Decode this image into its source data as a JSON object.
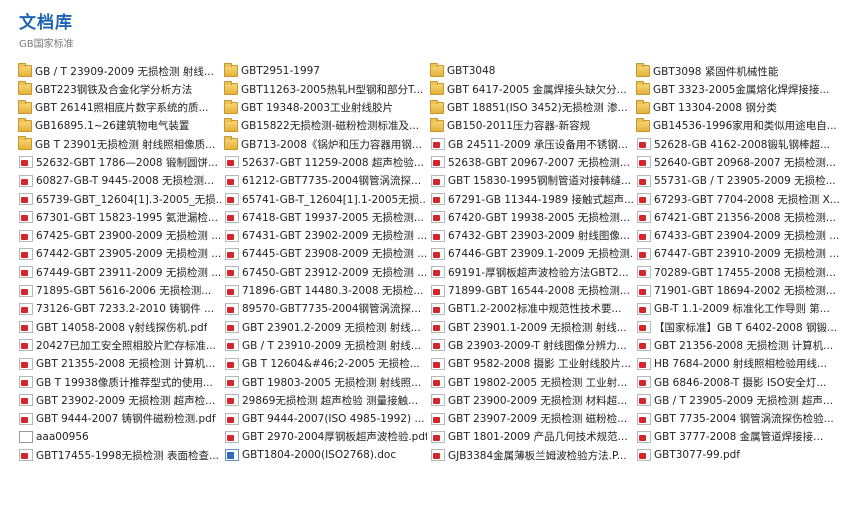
{
  "header": {
    "title": "文档库",
    "subtitle": "GB国家标准"
  },
  "files": [
    {
      "type": "folder",
      "name": "GB / T 23909-2009 无损检测 射线..."
    },
    {
      "type": "folder",
      "name": "GBT2951-1997"
    },
    {
      "type": "folder",
      "name": "GBT3048"
    },
    {
      "type": "folder",
      "name": "GBT3098 紧固件机械性能"
    },
    {
      "type": "folder",
      "name": "GBT223钢铁及合金化学分析方法"
    },
    {
      "type": "folder",
      "name": "GBT11263-2005热轧H型钢和部分T..."
    },
    {
      "type": "folder",
      "name": "GBT 6417-2005 金属焊接头缺欠分..."
    },
    {
      "type": "folder",
      "name": "GBT 3323-2005金属熔化焊焊接接..."
    },
    {
      "type": "folder",
      "name": "GBT 26141照相底片数字系统的质..."
    },
    {
      "type": "folder",
      "name": "GBT 19348-2003工业射线胶片"
    },
    {
      "type": "folder",
      "name": "GBT 18851(ISO 3452)无损检测 渗..."
    },
    {
      "type": "folder",
      "name": "GBT 13304-2008 钢分类"
    },
    {
      "type": "folder",
      "name": "GB16895.1~26建筑物电气装置"
    },
    {
      "type": "folder",
      "name": "GB15822无损检测-磁粉检测标准及..."
    },
    {
      "type": "folder",
      "name": "GB150-2011压力容器-新容规"
    },
    {
      "type": "folder",
      "name": "GB14536-1996家用和类似用途电自..."
    },
    {
      "type": "folder",
      "name": "GB T 23901无损检测 射线照相像质..."
    },
    {
      "type": "folder",
      "name": "GB713-2008《锅炉和压力容器用钢..."
    },
    {
      "type": "pdf",
      "name": "GB 24511-2009 承压设备用不锈钢..."
    },
    {
      "type": "pdf",
      "name": "52628-GB 4162-2008锻轧钢棒超..."
    },
    {
      "type": "pdf",
      "name": "52632-GBT 1786—2008 锻制圆饼..."
    },
    {
      "type": "pdf",
      "name": "52637-GBT 11259-2008 超声检验..."
    },
    {
      "type": "pdf",
      "name": "52638-GBT 20967-2007 无损检测..."
    },
    {
      "type": "pdf",
      "name": "52640-GBT 20968-2007 无损检测..."
    },
    {
      "type": "pdf",
      "name": "60827-GB-T 9445-2008 无损检测..."
    },
    {
      "type": "pdf",
      "name": "61212-GBT7735-2004钢管涡流探..."
    },
    {
      "type": "pdf",
      "name": "GBT 15830-1995钢制管道对接韩缝..."
    },
    {
      "type": "pdf",
      "name": "55731-GB / T 23905-2009 无损检..."
    },
    {
      "type": "pdf",
      "name": "65739-GBT_12604[1].3-2005_无损..."
    },
    {
      "type": "pdf",
      "name": "65741-GB-T_12604[1].1-2005无损..."
    },
    {
      "type": "pdf",
      "name": "67291-GB 11344-1989 接触式超声..."
    },
    {
      "type": "pdf",
      "name": "67293-GBT 7704-2008 无损检测 X..."
    },
    {
      "type": "pdf",
      "name": "67301-GBT 15823-1995 氦泄漏检..."
    },
    {
      "type": "pdf",
      "name": "67418-GBT 19937-2005 无损检测..."
    },
    {
      "type": "pdf",
      "name": "67420-GBT 19938-2005 无损检测..."
    },
    {
      "type": "pdf",
      "name": "67421-GBT 21356-2008 无损检测..."
    },
    {
      "type": "pdf",
      "name": "67425-GBT 23900-2009 无损检测 ..."
    },
    {
      "type": "pdf",
      "name": "67431-GBT 23902-2009 无损检测 ..."
    },
    {
      "type": "pdf",
      "name": "67432-GBT 23903-2009 射线图像..."
    },
    {
      "type": "pdf",
      "name": "67433-GBT 23904-2009 无损检测 ..."
    },
    {
      "type": "pdf",
      "name": "67442-GBT 23905-2009 无损检测 ..."
    },
    {
      "type": "pdf",
      "name": "67445-GBT 23908-2009 无损检测 ..."
    },
    {
      "type": "pdf",
      "name": "67446-GBT 23909.1-2009 无损检测..."
    },
    {
      "type": "pdf",
      "name": "67447-GBT 23910-2009 无损检测 ..."
    },
    {
      "type": "pdf",
      "name": "67449-GBT 23911-2009 无损检测 ..."
    },
    {
      "type": "pdf",
      "name": "67450-GBT 23912-2009 无损检测 ..."
    },
    {
      "type": "pdf",
      "name": "69191-厚钢板超声波检验方法GBT2..."
    },
    {
      "type": "pdf",
      "name": "70289-GBT 17455-2008 无损检测..."
    },
    {
      "type": "pdf",
      "name": "71895-GBT 5616-2006 无损检测..."
    },
    {
      "type": "pdf",
      "name": "71896-GBT 14480.3-2008 无损检..."
    },
    {
      "type": "pdf",
      "name": "71899-GBT 16544-2008 无损检测..."
    },
    {
      "type": "pdf",
      "name": "71901-GBT 18694-2002 无损检测..."
    },
    {
      "type": "pdf",
      "name": "73126-GBT 7233.2-2010 铸钢件 ..."
    },
    {
      "type": "pdf",
      "name": "89570-GBT7735-2004钢管涡流探..."
    },
    {
      "type": "pdf",
      "name": "GBT1.2-2002标准中规范性技术要..."
    },
    {
      "type": "pdf",
      "name": "GB-T 1.1-2009 标准化工作导则 第..."
    },
    {
      "type": "pdf",
      "name": "GBT 14058-2008 γ射线探伤机.pdf"
    },
    {
      "type": "pdf",
      "name": "GBT 23901.2-2009 无损检测 射线..."
    },
    {
      "type": "pdf",
      "name": "GBT 23901.1-2009 无损检测 射线..."
    },
    {
      "type": "pdf",
      "name": "【国家标准】GB T 6402-2008 钢锻..."
    },
    {
      "type": "pdf",
      "name": "20427已加工安全照相胶片贮存标准..."
    },
    {
      "type": "pdf",
      "name": "GB / T 23910-2009 无损检测 射线..."
    },
    {
      "type": "pdf",
      "name": "GB 23903-2009-T 射线图像分辨力..."
    },
    {
      "type": "pdf",
      "name": "GBT 21356-2008 无损检测 计算机..."
    },
    {
      "type": "pdf",
      "name": "GBT 21355-2008 无损检测 计算机..."
    },
    {
      "type": "pdf",
      "name": "GB T 12604&#46;2-2005 无损检..."
    },
    {
      "type": "pdf",
      "name": "GBT 9582-2008 摄影 工业射线胶片..."
    },
    {
      "type": "pdf",
      "name": "HB 7684-2000 射线照相检验用线..."
    },
    {
      "type": "pdf",
      "name": "GB T 19938像质计推荐型式的使用..."
    },
    {
      "type": "pdf",
      "name": "GBT 19803-2005 无损检测 射线照..."
    },
    {
      "type": "pdf",
      "name": "GBT 19802-2005  无损检测 工业射..."
    },
    {
      "type": "pdf",
      "name": "GB 6846-2008-T 摄影 ISO安全灯..."
    },
    {
      "type": "pdf",
      "name": "GBT 23902-2009 无损检测 超声检..."
    },
    {
      "type": "pdf",
      "name": "29869无损检测 超声检验 测量接触..."
    },
    {
      "type": "pdf",
      "name": "GBT 23900-2009 无损检测 材料超..."
    },
    {
      "type": "pdf",
      "name": "GB / T 23905-2009 无损检测 超声..."
    },
    {
      "type": "pdf",
      "name": "GBT 9444-2007 铸钢件磁粉检测.pdf"
    },
    {
      "type": "pdf",
      "name": "GBT 9444-2007(ISO 4985-1992) ..."
    },
    {
      "type": "pdf",
      "name": "GBT 23907-2009 无损检测 磁粉检..."
    },
    {
      "type": "pdf",
      "name": "GBT 7735-2004 钢管涡流探伤检验..."
    },
    {
      "type": "file",
      "name": "aaa00956"
    },
    {
      "type": "pdf",
      "name": "GBT 2970-2004厚钢板超声波检验.pdf"
    },
    {
      "type": "pdf",
      "name": "GBT 1801-2009 产品几何技术规范..."
    },
    {
      "type": "pdf",
      "name": "GBT 3777-2008 金属管道焊接接..."
    },
    {
      "type": "pdf",
      "name": "GBT17455-1998无损检测 表面检查..."
    },
    {
      "type": "doc",
      "name": "GBT1804-2000(ISO2768).doc"
    },
    {
      "type": "pdf",
      "name": "GJB3384金属薄板兰姆波检验方法.P..."
    },
    {
      "type": "pdf",
      "name": "GBT3077-99.pdf"
    }
  ]
}
